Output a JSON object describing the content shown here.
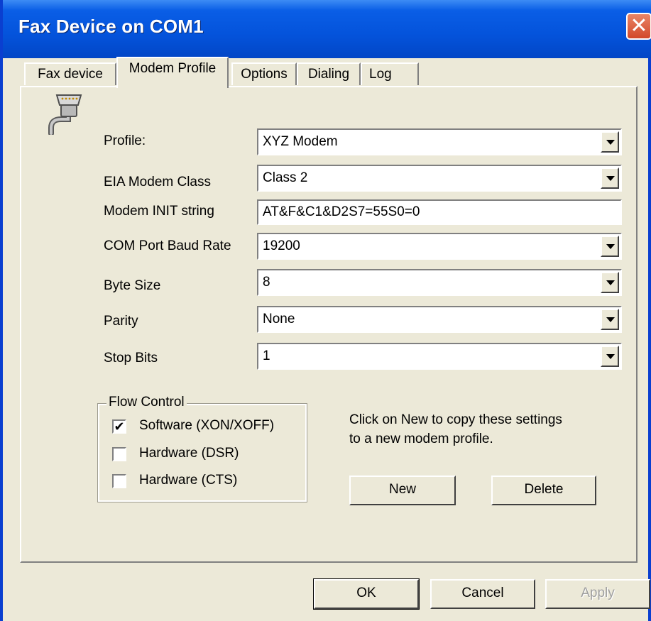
{
  "window": {
    "title": "Fax Device on COM1",
    "close_glyph": "✕"
  },
  "tabs": [
    {
      "label": "Fax device",
      "active": false
    },
    {
      "label": "Modem Profile",
      "active": true
    },
    {
      "label": "Options",
      "active": false
    },
    {
      "label": "Dialing",
      "active": false
    },
    {
      "label": "Log",
      "active": false
    }
  ],
  "icons": {
    "header": "serial-port-plug-icon"
  },
  "form": {
    "profile_label": "Profile:",
    "profile_value": "XYZ Modem",
    "eia_label": "EIA Modem Class",
    "eia_value": "Class 2",
    "init_label": "Modem INIT string",
    "init_value": "AT&F&C1&D2S7=55S0=0",
    "baud_label": "COM Port Baud Rate",
    "baud_value": "19200",
    "byte_label": "Byte Size",
    "byte_value": "8",
    "parity_label": "Parity",
    "parity_value": "None",
    "stop_label": "Stop Bits",
    "stop_value": "1"
  },
  "flow_control": {
    "title": "Flow Control",
    "options": [
      {
        "label": "Software (XON/XOFF)",
        "checked": true
      },
      {
        "label": "Hardware (DSR)",
        "checked": false
      },
      {
        "label": "Hardware (CTS)",
        "checked": false
      }
    ]
  },
  "info_text_line1": "Click on New to copy these settings",
  "info_text_line2": "to a new modem profile.",
  "buttons": {
    "new": "New",
    "delete": "Delete",
    "ok": "OK",
    "cancel": "Cancel",
    "apply": "Apply",
    "apply_disabled": true
  },
  "colors": {
    "title_bar": "#0453DB",
    "dialog_bg": "#ECE9D8",
    "close_button": "#D2482A"
  }
}
